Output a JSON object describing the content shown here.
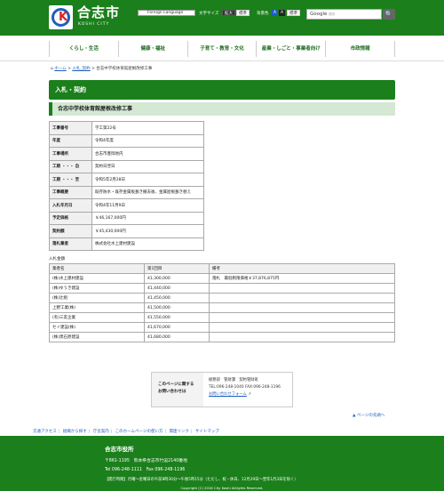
{
  "header": {
    "logo_char": "K",
    "logo_name": "合志市",
    "logo_sub": "KOSHI CITY",
    "foreign_language": "Foreign Language",
    "font_size_label": "文字サイズ",
    "font_large": "拡大",
    "font_standard": "標準",
    "bg_color_label": "背景色",
    "color_a1": "A",
    "color_a2": "A",
    "color_standard": "標準",
    "search_placeholder": "Google",
    "search_sub": "提供",
    "search_btn": "🔍"
  },
  "nav": [
    "くらし・生活",
    "健康・福祉",
    "子育て・教育・文化",
    "産業・しごと・事業者向け",
    "市政情報"
  ],
  "breadcrumb": {
    "home": "ホーム",
    "sep": ">",
    "level1": "入札_契約",
    "current": "合志中学校体育館屋根改修工事"
  },
  "section_title": "入札・契約",
  "page_title": "合志中学校体育館屋根改修工事",
  "info_rows": [
    {
      "label": "工事番号",
      "value": "学工第22号"
    },
    {
      "label": "年度",
      "value": "令和4年度"
    },
    {
      "label": "工事場所",
      "value": "合志市豊岡地内"
    },
    {
      "label": "工期 ・・・ 自",
      "value": "契約日翌日"
    },
    {
      "label": "工期 ・・・ 至",
      "value": "令和5年2月28日"
    },
    {
      "label": "工事概要",
      "value": "既存防水・既存金属板葺き撤去後、金属屋根葺き替え"
    },
    {
      "label": "入札年月日",
      "value": "令和4年11月9日"
    },
    {
      "label": "予定価格",
      "value": "￥46,167,000円"
    },
    {
      "label": "契約額",
      "value": "￥45,430,000円"
    },
    {
      "label": "落札業者",
      "value": "株式会社水上建材建設"
    }
  ],
  "bid_caption": "入札金額",
  "bid_headers": [
    "業者名",
    "第1回目",
    "備考"
  ],
  "bid_rows": [
    {
      "name": "(株)水上建材建設",
      "amount": "41,300,000",
      "note": "落札　最低制限価格￥37,876,875円"
    },
    {
      "name": "(株)ゆうき建設",
      "amount": "41,440,000",
      "note": ""
    },
    {
      "name": "(株)辻組",
      "amount": "41,450,000",
      "note": ""
    },
    {
      "name": "上野工業(株)",
      "amount": "41,500,000",
      "note": ""
    },
    {
      "name": "(有)三友企業",
      "amount": "41,550,000",
      "note": ""
    },
    {
      "name": "セイ建設(株)",
      "amount": "41,670,000",
      "note": ""
    },
    {
      "name": "(株)黒石原建設",
      "amount": "41,680,000",
      "note": ""
    }
  ],
  "contact": {
    "title1": "このページに関する",
    "title2": "お問い合わせは",
    "dept": "総務部　管財課　契約管財班",
    "tel": "TEL:096-248-1040 FAX:096-248-1196",
    "form_link": "お問い合わせフォーム"
  },
  "page_top": "ページの先頭へ",
  "footer_links": [
    "交通アクセス",
    "組織から探す",
    "庁舎案内",
    "このホームページの使い方",
    "関連リンク",
    "サイトマップ"
  ],
  "footer": {
    "name": "合志市役所",
    "address": "〒861-1195　熊本県合志市竹迫2140番地",
    "tel": "Tel 096-248-1111　Fax 096-248-1196",
    "hours": "【開庁時間】月曜～金曜日の午前8時30分～午後5時15分（ただし、祝・休日、12月29日～翌年1月3日を除く）",
    "copyright": "Copyright (C) 2016 City Koshi Allrights Reserved."
  },
  "colors": {
    "brand_green": "#1b7f1b",
    "light_green": "#d4e8d4",
    "link_blue": "#1e5fbf"
  }
}
